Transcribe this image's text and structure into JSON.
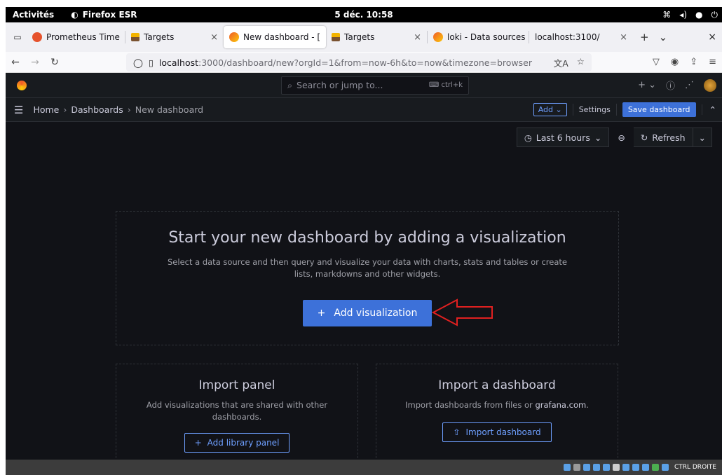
{
  "topbar": {
    "activities": "Activités",
    "app_name": "Firefox ESR",
    "clock": "5 déc. 10:58"
  },
  "tabs": [
    {
      "label": "Prometheus Time ",
      "icon": "prometheus-icon"
    },
    {
      "label": "Targets",
      "icon": "targets-icon"
    },
    {
      "label": "New dashboard - [",
      "icon": "grafana-icon",
      "active": true
    },
    {
      "label": "Targets",
      "icon": "targets-icon"
    },
    {
      "label": "loki - Data sources",
      "icon": "grafana-icon"
    },
    {
      "label": "localhost:3100/",
      "icon": ""
    }
  ],
  "url": {
    "host": "localhost",
    "path": ":3000/dashboard/new?orgId=1&from=now-6h&to=now&timezone=browser"
  },
  "grafana": {
    "search_placeholder": "Search or jump to...",
    "search_shortcut": "ctrl+k",
    "breadcrumbs": [
      "Home",
      "Dashboards",
      "New dashboard"
    ],
    "add_label": "Add",
    "settings_label": "Settings",
    "save_label": "Save dashboard",
    "time_range": "Last 6 hours",
    "refresh_label": "Refresh",
    "empty_title": "Start your new dashboard by adding a visualization",
    "empty_desc": "Select a data source and then query and visualize your data with charts, stats and tables or create lists, markdowns and other widgets.",
    "add_viz_label": "Add visualization",
    "import_panel_title": "Import panel",
    "import_panel_desc": "Add visualizations that are shared with other dashboards.",
    "add_library_label": "Add library panel",
    "import_dash_title": "Import a dashboard",
    "import_dash_desc_prefix": "Import dashboards from files or ",
    "import_dash_desc_link": "grafana.com",
    "import_dash_desc_suffix": ".",
    "import_dash_label": "Import dashboard"
  },
  "bottom": {
    "label": "CTRL DROITE"
  },
  "colors": {
    "grafana_bg": "#111217",
    "primary": "#3d71d9",
    "arrow": "#e02020"
  }
}
